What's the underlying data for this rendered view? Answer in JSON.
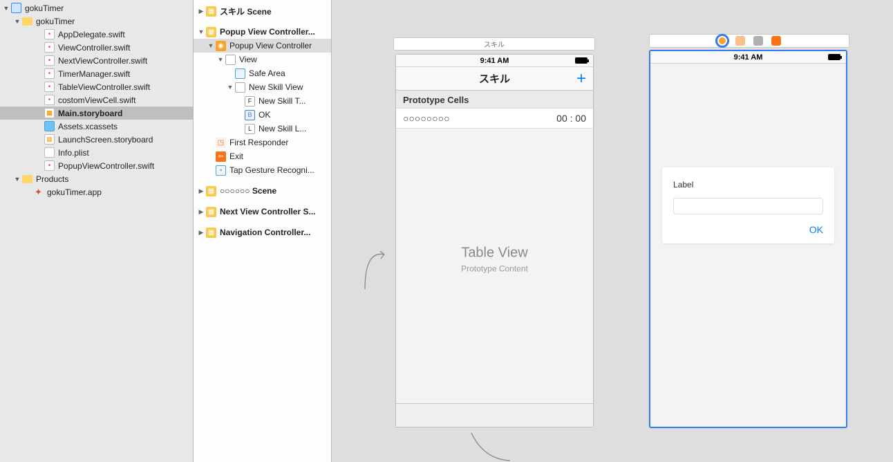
{
  "navigator": {
    "items": [
      {
        "d": "down",
        "in": 0,
        "icon": "icon-project",
        "label": "gokuTimer"
      },
      {
        "d": "down",
        "in": 1,
        "icon": "icon-folder",
        "label": "gokuTimer"
      },
      {
        "d": "blank",
        "in": 3,
        "icon": "icon-swift",
        "label": "AppDelegate.swift"
      },
      {
        "d": "blank",
        "in": 3,
        "icon": "icon-swift",
        "label": "ViewController.swift"
      },
      {
        "d": "blank",
        "in": 3,
        "icon": "icon-swift",
        "label": "NextViewController.swift"
      },
      {
        "d": "blank",
        "in": 3,
        "icon": "icon-swift",
        "label": "TimerManager.swift"
      },
      {
        "d": "blank",
        "in": 3,
        "icon": "icon-swift",
        "label": "TableViewController.swift"
      },
      {
        "d": "blank",
        "in": 3,
        "icon": "icon-swift",
        "label": "costomViewCell.swift"
      },
      {
        "d": "blank",
        "in": 3,
        "icon": "icon-story",
        "label": "Main.storyboard",
        "sel": true
      },
      {
        "d": "blank",
        "in": 3,
        "icon": "icon-assets",
        "label": "Assets.xcassets"
      },
      {
        "d": "blank",
        "in": 3,
        "icon": "icon-story",
        "label": "LaunchScreen.storyboard"
      },
      {
        "d": "blank",
        "in": 3,
        "icon": "icon-plist",
        "label": "Info.plist"
      },
      {
        "d": "blank",
        "in": 3,
        "icon": "icon-swift",
        "label": "PopupViewController.swift"
      },
      {
        "d": "down",
        "in": 1,
        "icon": "icon-folder",
        "label": "Products"
      },
      {
        "d": "blank",
        "in": 2,
        "icon": "icon-app",
        "label": "gokuTimer.app"
      }
    ]
  },
  "outline": {
    "items": [
      {
        "d": "right",
        "in": 0,
        "ic": "ic-scene",
        "label": "スキル Scene",
        "bold": true
      },
      {
        "d": "down",
        "in": 0,
        "ic": "ic-scene",
        "label": "Popup View Controller...",
        "bold": true,
        "spaced": true
      },
      {
        "d": "down",
        "in": 1,
        "ic": "ic-vc",
        "label": "Popup View Controller",
        "sel": true
      },
      {
        "d": "down",
        "in": 2,
        "ic": "ic-view",
        "label": "View"
      },
      {
        "d": "blank",
        "in": 3,
        "ic": "ic-safe",
        "label": "Safe Area"
      },
      {
        "d": "down",
        "in": 3,
        "ic": "ic-view",
        "label": "New Skill View"
      },
      {
        "d": "blank",
        "in": 4,
        "ic": "ic-lblF",
        "label": "New Skill T..."
      },
      {
        "d": "blank",
        "in": 4,
        "ic": "ic-btn",
        "label": "OK"
      },
      {
        "d": "blank",
        "in": 4,
        "ic": "ic-lblL",
        "label": "New Skill L..."
      },
      {
        "d": "blank",
        "in": 1,
        "ic": "ic-first",
        "label": "First Responder"
      },
      {
        "d": "blank",
        "in": 1,
        "ic": "ic-exit",
        "label": "Exit"
      },
      {
        "d": "blank",
        "in": 1,
        "ic": "ic-tap",
        "label": "Tap Gesture Recogni..."
      },
      {
        "d": "right",
        "in": 0,
        "ic": "ic-scene",
        "label": "○○○○○○ Scene",
        "bold": true,
        "spaced": true
      },
      {
        "d": "right",
        "in": 0,
        "ic": "ic-scene",
        "label": "Next View Controller S...",
        "bold": true,
        "spaced": true
      },
      {
        "d": "right",
        "in": 0,
        "ic": "ic-scene",
        "label": "Navigation Controller...",
        "bold": true,
        "spaced": true
      }
    ]
  },
  "canvas": {
    "skill_scene": {
      "title_bar": "スキル",
      "status_time": "9:41 AM",
      "nav_title": "スキル",
      "add_glyph": "+",
      "proto_header": "Prototype Cells",
      "cell_left": "○○○○○○○○",
      "cell_right": "00 : 00",
      "placeholder_h": "Table View",
      "placeholder_s": "Prototype Content"
    },
    "popup_scene": {
      "status_time": "9:41 AM",
      "card_label": "Label",
      "ok_label": "OK"
    }
  }
}
